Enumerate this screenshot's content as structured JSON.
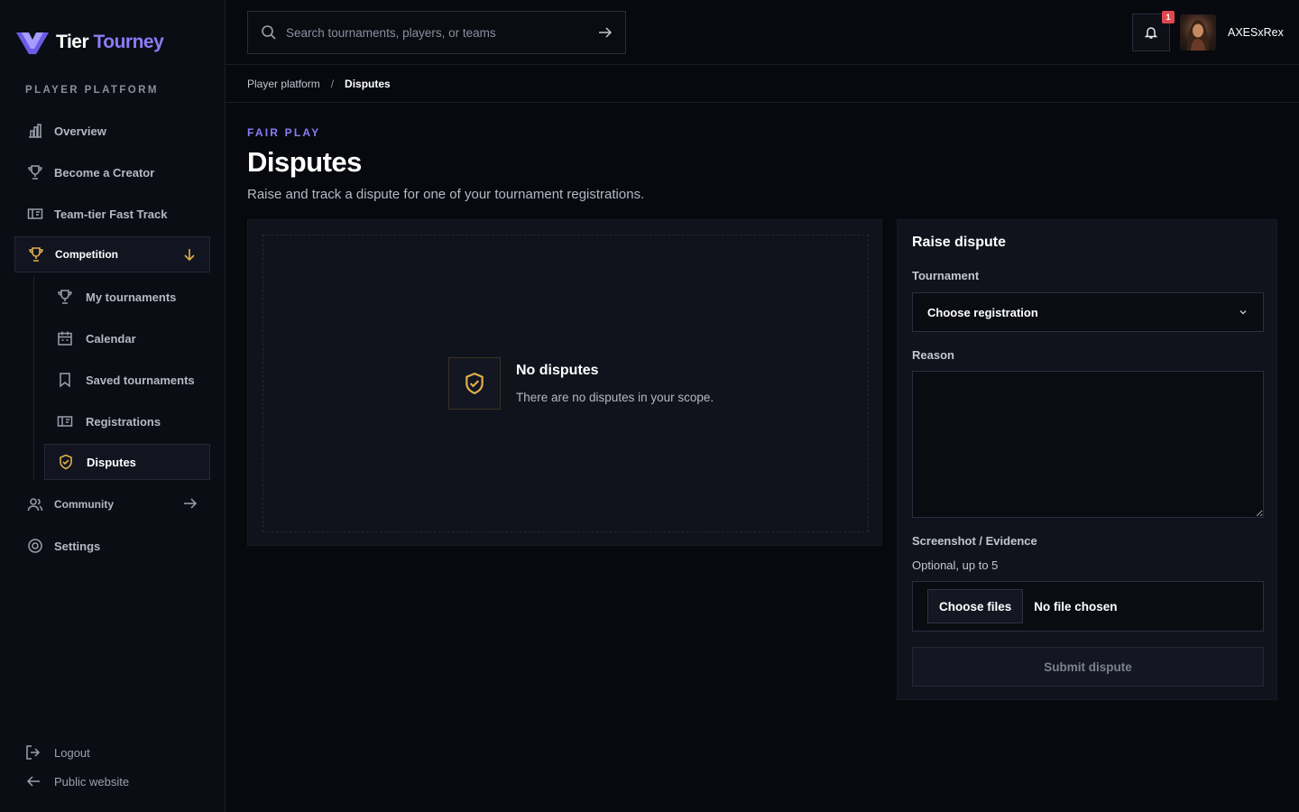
{
  "brand": {
    "name_part1": "Tier",
    "name_part2": "Tourney",
    "accent": "#8b7cf6"
  },
  "sidebar": {
    "section_label": "PLAYER PLATFORM",
    "items": [
      {
        "label": "Overview",
        "icon": "bar-chart-icon"
      },
      {
        "label": "Become a Creator",
        "icon": "trophy-icon"
      },
      {
        "label": "Team-tier Fast Track",
        "icon": "ticket-icon"
      },
      {
        "label": "Competition",
        "icon": "trophy-icon",
        "expanded": true
      },
      {
        "label": "Community",
        "icon": "users-icon"
      },
      {
        "label": "Settings",
        "icon": "gear-icon"
      }
    ],
    "sub_items": [
      {
        "label": "My tournaments",
        "icon": "trophy-icon"
      },
      {
        "label": "Calendar",
        "icon": "calendar-icon"
      },
      {
        "label": "Saved tournaments",
        "icon": "bookmark-icon"
      },
      {
        "label": "Registrations",
        "icon": "ticket-icon"
      },
      {
        "label": "Disputes",
        "icon": "shield-check-icon",
        "current": true
      }
    ],
    "bottom": {
      "logout": "Logout",
      "public_site": "Public website"
    }
  },
  "header": {
    "search_placeholder": "Search tournaments, players, or teams",
    "notification_count": "1",
    "username": "AXESxRex"
  },
  "breadcrumb": {
    "parent": "Player platform",
    "separator": "/",
    "current": "Disputes"
  },
  "page": {
    "eyebrow": "FAIR PLAY",
    "title": "Disputes",
    "subtitle": "Raise and track a dispute for one of your tournament registrations."
  },
  "empty_state": {
    "title": "No disputes",
    "text": "There are no disputes in your scope."
  },
  "form": {
    "title": "Raise dispute",
    "tournament_label": "Tournament",
    "tournament_value": "Choose registration",
    "reason_label": "Reason",
    "evidence_label": "Screenshot / Evidence",
    "evidence_hint": "Optional, up to 5",
    "choose_files": "Choose files",
    "no_file": "No file chosen",
    "submit": "Submit dispute"
  },
  "colors": {
    "background": "#07090f",
    "panel": "#10131c",
    "gold": "#e0b04a",
    "badge": "#e0484e"
  }
}
